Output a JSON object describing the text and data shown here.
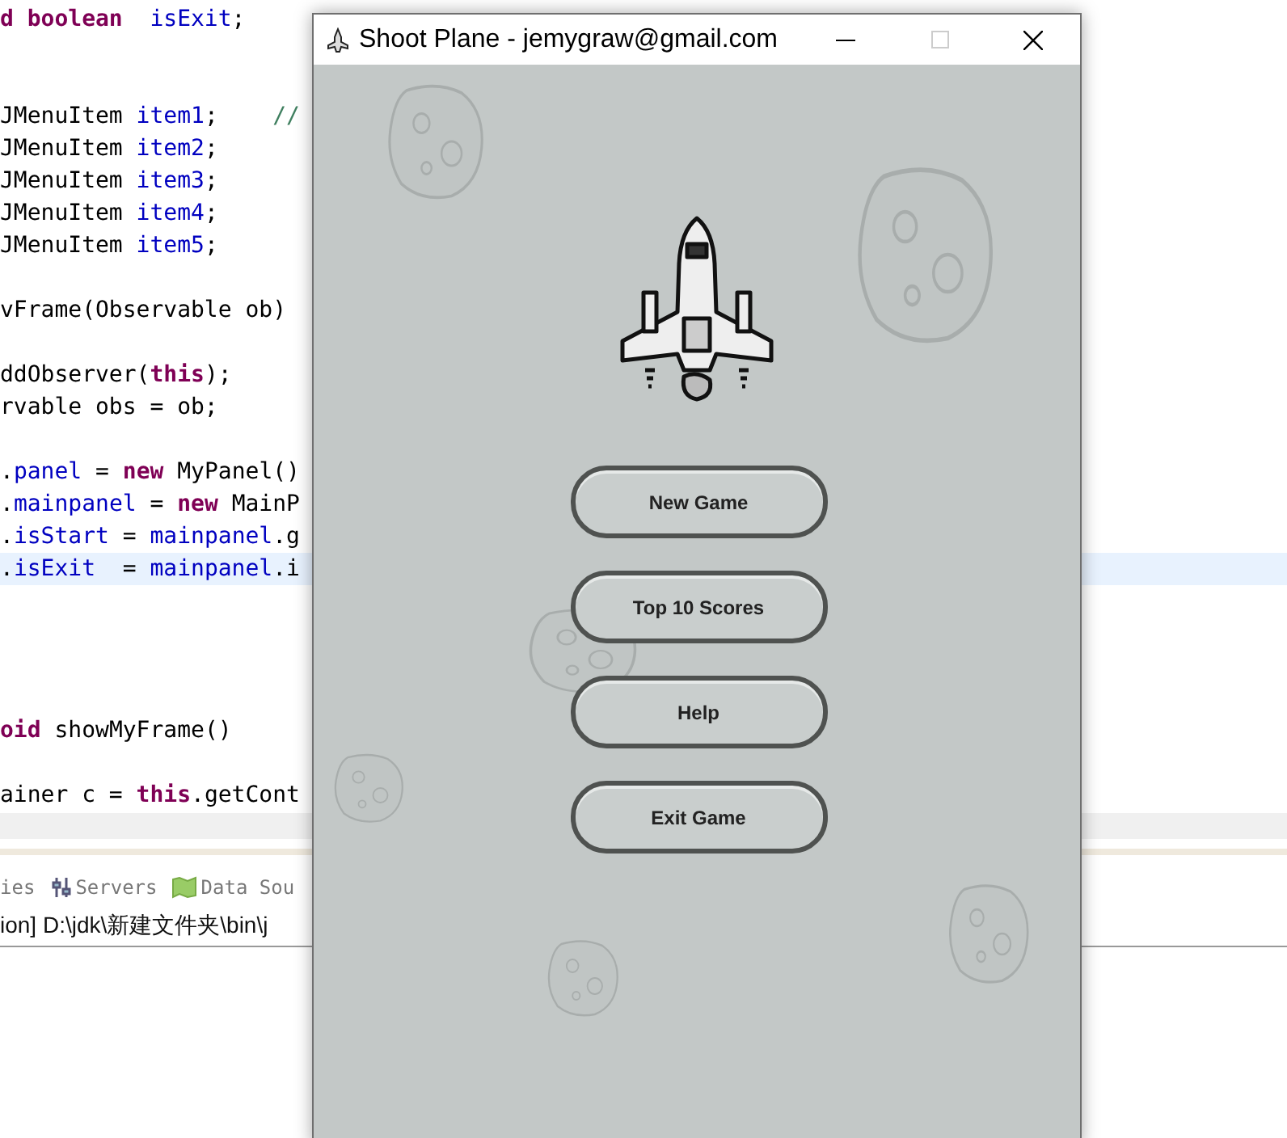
{
  "editor": {
    "lines": [
      {
        "kind": "code",
        "current": false,
        "tokens": [
          {
            "text": "d boolean",
            "kind": "keyword"
          },
          {
            "text": "  isExit",
            "kind": "field"
          },
          {
            "text": ";",
            "kind": "plain"
          }
        ]
      },
      {
        "kind": "blank"
      },
      {
        "kind": "blank"
      },
      {
        "kind": "code",
        "current": false,
        "tokens": [
          {
            "text": "JMenuItem ",
            "kind": "plain"
          },
          {
            "text": "item1",
            "kind": "field"
          },
          {
            "text": ";    ",
            "kind": "plain"
          },
          {
            "text": "//",
            "kind": "comment"
          }
        ]
      },
      {
        "kind": "code",
        "current": false,
        "tokens": [
          {
            "text": "JMenuItem ",
            "kind": "plain"
          },
          {
            "text": "item2",
            "kind": "field"
          },
          {
            "text": ";",
            "kind": "plain"
          }
        ]
      },
      {
        "kind": "code",
        "current": false,
        "tokens": [
          {
            "text": "JMenuItem ",
            "kind": "plain"
          },
          {
            "text": "item3",
            "kind": "field"
          },
          {
            "text": ";",
            "kind": "plain"
          }
        ]
      },
      {
        "kind": "code",
        "current": false,
        "tokens": [
          {
            "text": "JMenuItem ",
            "kind": "plain"
          },
          {
            "text": "item4",
            "kind": "field"
          },
          {
            "text": ";",
            "kind": "plain"
          }
        ]
      },
      {
        "kind": "code",
        "current": false,
        "tokens": [
          {
            "text": "JMenuItem ",
            "kind": "plain"
          },
          {
            "text": "item5",
            "kind": "field"
          },
          {
            "text": ";",
            "kind": "plain"
          }
        ]
      },
      {
        "kind": "blank"
      },
      {
        "kind": "code",
        "current": false,
        "tokens": [
          {
            "text": "vFrame(Observable ob)",
            "kind": "plain"
          }
        ]
      },
      {
        "kind": "blank"
      },
      {
        "kind": "code",
        "current": false,
        "tokens": [
          {
            "text": "ddObserver(",
            "kind": "plain"
          },
          {
            "text": "this",
            "kind": "keyword"
          },
          {
            "text": ");",
            "kind": "plain"
          }
        ]
      },
      {
        "kind": "code",
        "current": false,
        "tokens": [
          {
            "text": "rvable obs = ob;",
            "kind": "plain"
          }
        ]
      },
      {
        "kind": "blank"
      },
      {
        "kind": "code",
        "current": false,
        "tokens": [
          {
            "text": ".",
            "kind": "plain"
          },
          {
            "text": "panel",
            "kind": "field"
          },
          {
            "text": " = ",
            "kind": "plain"
          },
          {
            "text": "new",
            "kind": "keyword"
          },
          {
            "text": " MyPanel()",
            "kind": "plain"
          }
        ]
      },
      {
        "kind": "code",
        "current": false,
        "tokens": [
          {
            "text": ".",
            "kind": "plain"
          },
          {
            "text": "mainpanel",
            "kind": "field"
          },
          {
            "text": " = ",
            "kind": "plain"
          },
          {
            "text": "new",
            "kind": "keyword"
          },
          {
            "text": " MainP",
            "kind": "plain"
          }
        ]
      },
      {
        "kind": "code",
        "current": false,
        "tokens": [
          {
            "text": ".",
            "kind": "plain"
          },
          {
            "text": "isStart",
            "kind": "field"
          },
          {
            "text": " = ",
            "kind": "plain"
          },
          {
            "text": "mainpanel",
            "kind": "field"
          },
          {
            "text": ".g",
            "kind": "plain"
          }
        ]
      },
      {
        "kind": "code",
        "current": true,
        "tokens": [
          {
            "text": ".",
            "kind": "plain"
          },
          {
            "text": "isExit",
            "kind": "field"
          },
          {
            "text": "  = ",
            "kind": "plain"
          },
          {
            "text": "mainpanel",
            "kind": "field"
          },
          {
            "text": ".i",
            "kind": "plain"
          }
        ]
      },
      {
        "kind": "blank"
      },
      {
        "kind": "blank"
      },
      {
        "kind": "blank"
      },
      {
        "kind": "blank"
      },
      {
        "kind": "code",
        "current": false,
        "tokens": [
          {
            "text": "oid",
            "kind": "keyword"
          },
          {
            "text": " showMyFrame()",
            "kind": "plain"
          }
        ]
      },
      {
        "kind": "blank"
      },
      {
        "kind": "code",
        "current": false,
        "tokens": [
          {
            "text": "ainer c = ",
            "kind": "plain"
          },
          {
            "text": "this",
            "kind": "keyword"
          },
          {
            "text": ".getCont",
            "kind": "plain"
          }
        ]
      }
    ]
  },
  "bottom_panel": {
    "tabs": [
      {
        "label": "ies"
      },
      {
        "label": "Servers"
      },
      {
        "label": "Data Sou"
      }
    ],
    "console_line": "ion] D:\\jdk\\新建文件夹\\bin\\j"
  },
  "window": {
    "title": "Shoot Plane - jemygraw@gmail.com",
    "maximize_disabled": true,
    "menu_buttons": [
      "New Game",
      "Top 10 Scores",
      "Help",
      "Exit Game"
    ]
  }
}
